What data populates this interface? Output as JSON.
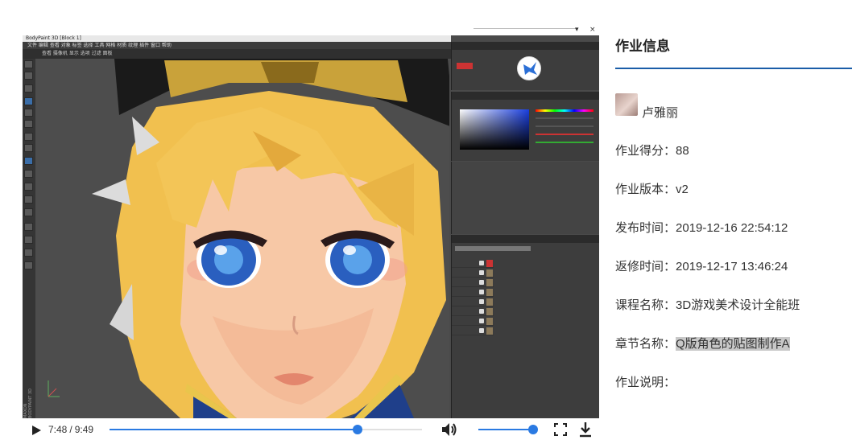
{
  "video": {
    "current_time": "7:48",
    "duration": "9:49",
    "time_separator": "/",
    "progress_fraction": 0.795,
    "buffered_fraction": 0.65,
    "volume_fraction": 1.0,
    "app_window_title": "BodyPaint 3D [Block 1]",
    "app_menu": "文件  编辑  查看  对象  标签  选择  工具  网格  材质  纹理  插件  窗口  帮助",
    "app_tabs": "查看  摄像机  显示  选项  过滤  面板",
    "maxon_label": "MAXON BODYPAINT 3D",
    "colors": {
      "accent": "#2a7ae2",
      "viewport_bg": "#4d4d4d",
      "panel_bg": "#3d3d3d"
    }
  },
  "info": {
    "title": "作业信息",
    "author_name": "卢雅丽",
    "rule_color": "#1a5da8",
    "fields": [
      {
        "label": "作业得分：",
        "value": "88"
      },
      {
        "label": "作业版本：",
        "value": "v2"
      },
      {
        "label": "发布时间：",
        "value": "2019-12-16 22:54:12"
      },
      {
        "label": "返修时间：",
        "value": "2019-12-17 13:46:24"
      },
      {
        "label": "课程名称：",
        "value": "3D游戏美术设计全能班"
      },
      {
        "label": "章节名称：",
        "value": "Q版角色的贴图制作A"
      },
      {
        "label": "作业说明：",
        "value": ""
      }
    ]
  },
  "icons": {
    "play": "play-icon",
    "volume": "volume-icon",
    "fullscreen": "fullscreen-icon",
    "download": "download-icon",
    "logo": "bird-logo-icon"
  }
}
